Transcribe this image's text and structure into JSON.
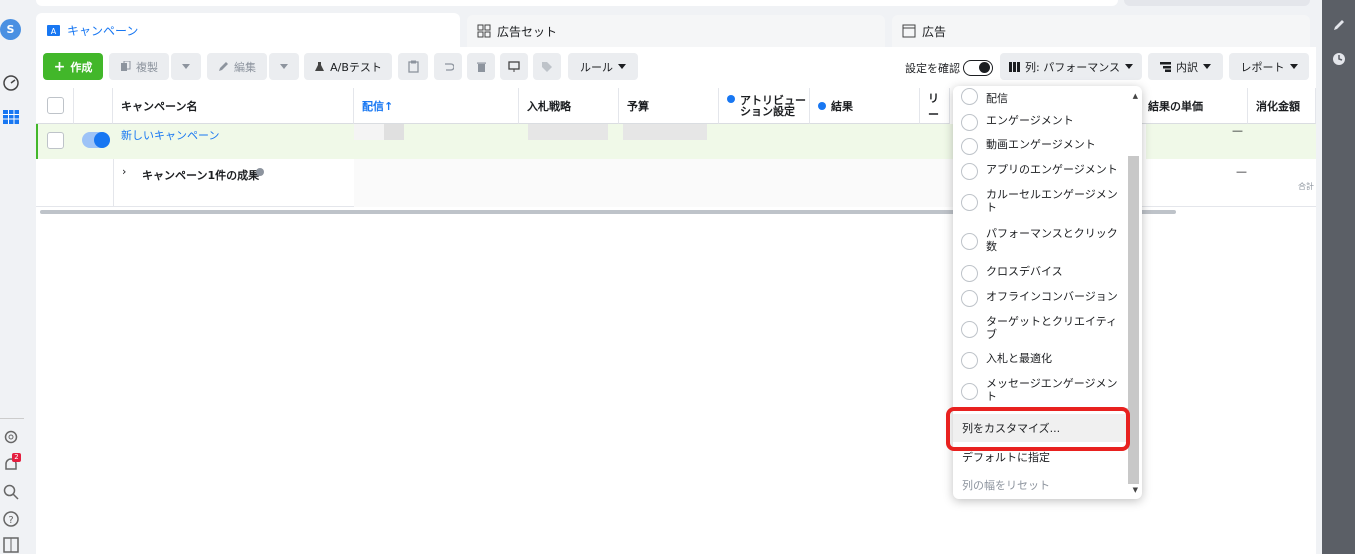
{
  "leftnav": {
    "avatar_letter": "S",
    "notification_count": "2"
  },
  "tabs": [
    {
      "label": "キャンペーン",
      "active": true
    },
    {
      "label": "広告セット",
      "active": false
    },
    {
      "label": "広告",
      "active": false
    }
  ],
  "toolbar": {
    "create": "作成",
    "duplicate": "複製",
    "edit": "編集",
    "ab_test": "A/Bテスト",
    "rules": "ルール",
    "settings_check": "設定を確認",
    "columns": "列: パフォーマンス",
    "breakdown": "内訳",
    "reports": "レポート"
  },
  "table": {
    "headers": [
      "キャンペーン名",
      "配信↑",
      "入札戦略",
      "予算",
      "アトリビューション設定",
      "結果",
      "リー",
      "結果の単価",
      "消化金額"
    ],
    "rows": [
      {
        "name": "新しいキャンペーン",
        "cost_per_result": "—"
      }
    ],
    "summary": {
      "label": "キャンペーン1件の成果",
      "cost_per_result": "—",
      "total_suffix": "合計"
    }
  },
  "column_menu": {
    "presets": [
      "配信",
      "エンゲージメント",
      "動画エンゲージメント",
      "アプリのエンゲージメント",
      "カルーセルエンゲージメント",
      "パフォーマンスとクリック数",
      "クロスデバイス",
      "オフラインコンバージョン",
      "ターゲットとクリエイティブ",
      "入札と最適化",
      "メッセージエンゲージメント"
    ],
    "customize": "列をカスタマイズ...",
    "set_default": "デフォルトに指定",
    "reset_width": "列の幅をリセット"
  },
  "colors": {
    "accent": "#1877f2",
    "create_button": "#42b72a",
    "highlight": "#e8211f"
  }
}
